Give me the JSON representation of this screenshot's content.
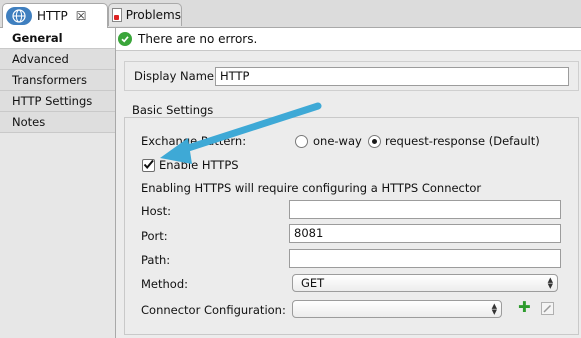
{
  "tabs": [
    {
      "label": "HTTP",
      "close": "☒",
      "active": true
    },
    {
      "label": "Problems",
      "active": false
    }
  ],
  "status": {
    "text": "There are no errors."
  },
  "nav": {
    "items": [
      "General",
      "Advanced",
      "Transformers",
      "HTTP Settings",
      "Notes"
    ]
  },
  "form": {
    "display_name_label": "Display Name:",
    "display_name_value": "HTTP",
    "basic_settings_title": "Basic Settings",
    "exchange_pattern_label": "Exchange Pattern:",
    "radio_oneway": "one-way",
    "radio_reqresp": "request-response (Default)",
    "enable_https_label": "Enable HTTPS",
    "https_note": "Enabling HTTPS will require configuring a HTTPS Connector",
    "host_label": "Host:",
    "host_value": "",
    "port_label": "Port:",
    "port_value": "8081",
    "path_label": "Path:",
    "path_value": "",
    "method_label": "Method:",
    "method_value": "GET",
    "connector_label": "Connector Configuration:",
    "connector_value": ""
  },
  "colors": {
    "accent_arrow": "#3ea9d6",
    "ok": "#3aa53a",
    "add": "#2d9b2d"
  }
}
